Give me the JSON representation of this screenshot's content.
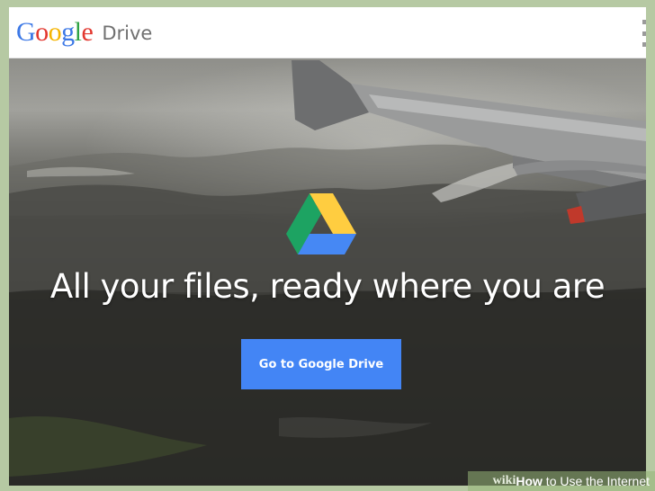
{
  "header": {
    "logo_letters": [
      {
        "char": "G",
        "color": "#3c78e6"
      },
      {
        "char": "o",
        "color": "#e2372f"
      },
      {
        "char": "o",
        "color": "#f5b400"
      },
      {
        "char": "g",
        "color": "#3c78e6"
      },
      {
        "char": "l",
        "color": "#2fa344"
      },
      {
        "char": "e",
        "color": "#e2372f"
      }
    ],
    "product_name": "Drive",
    "menu_icon": "overflow-menu-icon"
  },
  "hero": {
    "logo_icon": "google-drive-logo-icon",
    "headline": "All your files, ready where you are",
    "cta_label": "Go to Google Drive",
    "colors": {
      "cta": "#4385f5",
      "drive_green": "#1da362",
      "drive_yellow": "#ffcd40",
      "drive_blue": "#4688f4"
    }
  },
  "watermark": {
    "wiki": "wiki",
    "how": "How",
    "rest": " to Use the Internet"
  }
}
